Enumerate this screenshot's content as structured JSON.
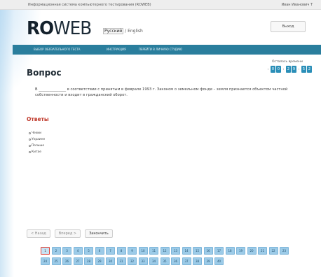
{
  "topbar": {
    "system_title": "Информационная система компьютерного тестирования (ROWEB)",
    "user_name": "Иван Иванович Т"
  },
  "header": {
    "logo_ro": "RO",
    "logo_web": "WEB",
    "lang_active": "Русский",
    "lang_separator": "/",
    "lang_other": "English",
    "logout_label": "Выход"
  },
  "navbar": {
    "items": [
      "ВЫБОР ОБЯЗАТЕЛЬНОГО ТЕСТА",
      "ИНСТРУКЦИЯ",
      "ПЕРЕЙТИ В ЛИЧНУЮ СТУДИЮ"
    ]
  },
  "timer": {
    "label": "Осталось времени",
    "digits": [
      "0",
      "0",
      "2",
      "9",
      "5",
      "2"
    ]
  },
  "question": {
    "title": "Вопрос",
    "text": "В _______________ в соответствии с принятым в феврале 1993 г. Законом о земельном фонде – земля признается объектом частной собственности и входит в гражданский оборот."
  },
  "answers": {
    "title": "Ответы",
    "options": [
      "Чехии",
      "Украине",
      "Польше",
      "Китае"
    ]
  },
  "buttons": {
    "prev": "< Назад",
    "next": "Вперед >",
    "finish": "Закончить"
  },
  "pager": {
    "current": "1",
    "pages": [
      "1",
      "2",
      "3",
      "4",
      "5",
      "6",
      "7",
      "8",
      "9",
      "10",
      "11",
      "12",
      "13",
      "14",
      "15",
      "16",
      "17",
      "18",
      "19",
      "20",
      "21",
      "22",
      "23",
      "24",
      "25",
      "26",
      "27",
      "28",
      "29",
      "30",
      "31",
      "32",
      "33",
      "34",
      "35",
      "36",
      "37",
      "38",
      "39",
      "40"
    ]
  },
  "colors": {
    "navbar": "#2a7e9d",
    "timer_digit": "#2b8fb8",
    "answers_title": "#c0392b",
    "pager_cell": "#9ccbe8",
    "pager_current_border": "#e0453a"
  }
}
